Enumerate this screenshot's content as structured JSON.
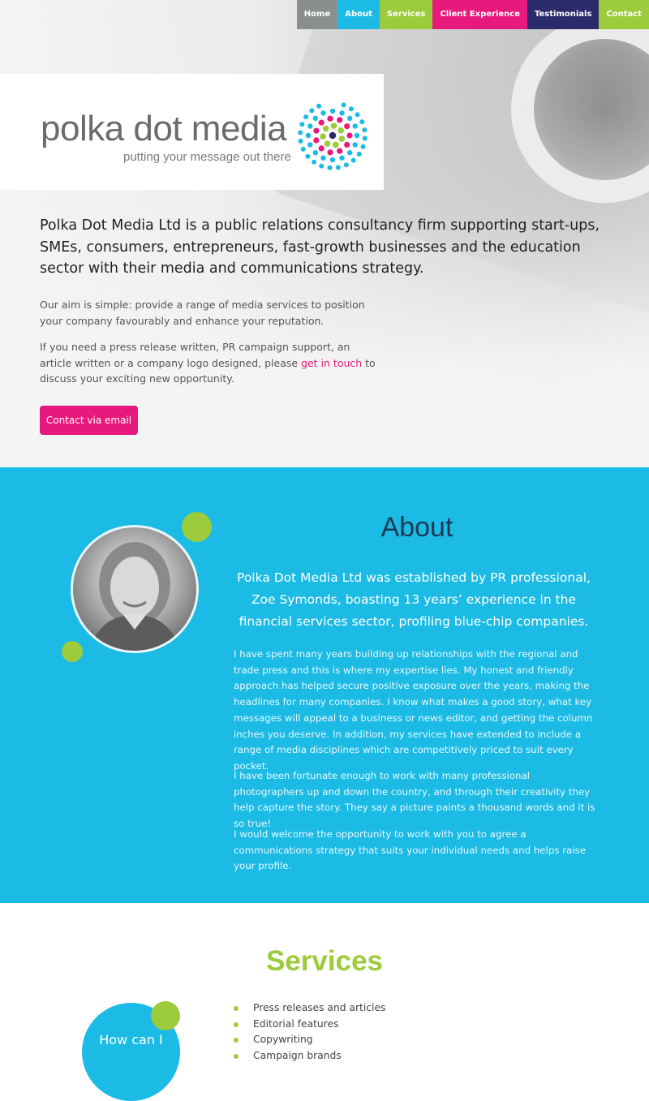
{
  "colors": {
    "pink": "#e8197c",
    "cyan": "#1bbbe5",
    "green": "#9ccb3b",
    "navy": "#2b2a6b",
    "grey": "#8b8e8f"
  },
  "nav": {
    "items": [
      {
        "label": "Home",
        "color": "#8b8e8f"
      },
      {
        "label": "About",
        "color": "#1bbbe5"
      },
      {
        "label": "Services",
        "color": "#9ccb3b"
      },
      {
        "label": "Client Experience",
        "color": "#e8197c"
      },
      {
        "label": "Testimonials",
        "color": "#2b2a6b"
      },
      {
        "label": "Contact",
        "color": "#9ccb3b"
      }
    ]
  },
  "logo": {
    "title": "polka dot media",
    "tagline": "putting your message out there"
  },
  "hero": {
    "lead": "Polka Dot Media Ltd is a public relations consultancy firm supporting start-ups, SMEs, consumers, entrepreneurs, fast-growth businesses and the education sector with their media and communications strategy.",
    "aim": "Our aim is simple: provide a range of media services to position your company favourably and enhance your reputation.",
    "contact_before": "If you need a press release written, PR campaign support, an article written or a company logo designed, please ",
    "contact_link": "get in touch",
    "contact_after": " to discuss your exciting new opportunity.",
    "button": "Contact via email"
  },
  "about": {
    "title": "About",
    "lead": "Polka Dot Media Ltd was established by PR professional, Zoe Symonds, boasting 13 years’ experience in the financial services sector, profiling blue-chip companies.",
    "p1": "I have spent many years building up relationships with the regional and trade press and this is where my expertise lies. My honest and friendly approach has helped secure positive exposure over the years, making the headlines for many companies. I know what makes a good story, what key messages will appeal to a business or news editor, and getting the column inches you deserve. In addition, my services have extended to include a range of media disciplines which are competitively priced to suit every pocket.",
    "p2": "I have been fortunate enough to work with many professional photographers up and down the country, and through their creativity they help capture the story. They say a picture paints a thousand words and it is so true!",
    "p3": "I would welcome the opportunity to work with you to agree a communications strategy that suits your individual needs and helps raise your profile."
  },
  "services": {
    "title": "Services",
    "circle_text": "How can I",
    "items": [
      "Press releases and articles",
      "Editorial features",
      "Copywriting",
      "Campaign brands"
    ]
  }
}
